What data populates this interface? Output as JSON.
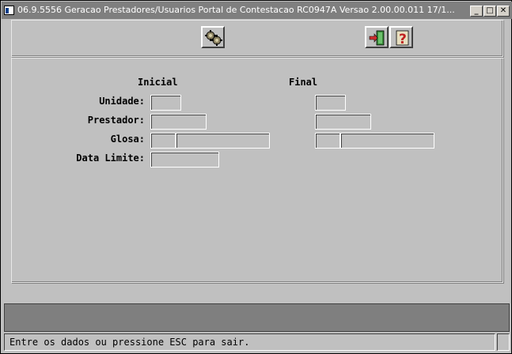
{
  "window": {
    "title": "06.9.5556 Geracao  Prestadores/Usuarios Portal de Contestacao RC0947A Versao 2.00.00.011 17/1...",
    "controls": {
      "minimize": "_",
      "maximize": "□",
      "close": "✕"
    }
  },
  "toolbar": {
    "buttons": [
      {
        "icon": "gears-icon",
        "action": "executar"
      },
      {
        "icon": "exit-door-icon",
        "action": "sair"
      },
      {
        "icon": "help-question-icon",
        "action": "ajuda"
      }
    ]
  },
  "form": {
    "column_initial": "Inicial",
    "column_final": "Final",
    "labels": {
      "unidade": "Unidade:",
      "prestador": "Prestador:",
      "glosa": "Glosa:",
      "data_limite": "Data Limite:"
    },
    "values": {
      "unidade_inicial": "",
      "unidade_final": "",
      "prestador_inicial": "",
      "prestador_final": "",
      "glosa_inicial_cod": "",
      "glosa_inicial_desc": "",
      "glosa_final_cod": "",
      "glosa_final_desc": "",
      "data_limite": ""
    }
  },
  "status": {
    "message": "Entre os dados ou pressione ESC para sair."
  },
  "colors": {
    "face": "#c0c0c0",
    "titlebar": "#7f7f7f",
    "darkbar": "#7f7f7f"
  }
}
